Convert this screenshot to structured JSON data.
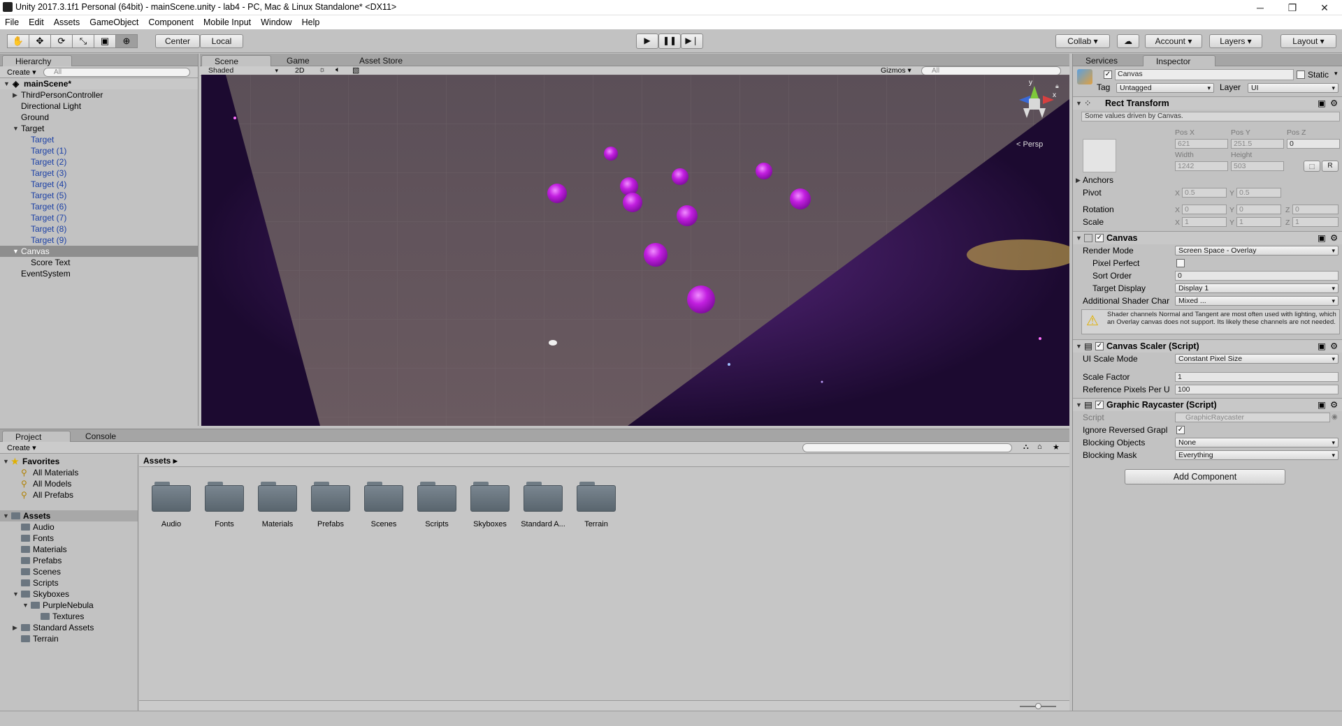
{
  "window": {
    "title": "Unity 2017.3.1f1 Personal (64bit) - mainScene.unity - lab4 - PC, Mac & Linux Standalone* <DX11>"
  },
  "menu": [
    "File",
    "Edit",
    "Assets",
    "GameObject",
    "Component",
    "Mobile Input",
    "Window",
    "Help"
  ],
  "toolbar": {
    "pivot_label": "Center",
    "space_label": "Local",
    "collab_label": "Collab",
    "account_label": "Account",
    "layers_label": "Layers",
    "layout_label": "Layout"
  },
  "hierarchy": {
    "tab_label": "Hierarchy",
    "create_label": "Create",
    "search_placeholder": "All",
    "scene_name": "mainScene*",
    "items": [
      {
        "label": "ThirdPersonController"
      },
      {
        "label": "Directional Light"
      },
      {
        "label": "Ground"
      },
      {
        "label": "Target"
      },
      {
        "label": "Target"
      },
      {
        "label": "Target (1)"
      },
      {
        "label": "Target (2)"
      },
      {
        "label": "Target (3)"
      },
      {
        "label": "Target (4)"
      },
      {
        "label": "Target (5)"
      },
      {
        "label": "Target (6)"
      },
      {
        "label": "Target (7)"
      },
      {
        "label": "Target (8)"
      },
      {
        "label": "Target (9)"
      },
      {
        "label": "Canvas"
      },
      {
        "label": "Score Text"
      },
      {
        "label": "EventSystem"
      }
    ]
  },
  "scene": {
    "tabs": [
      "Scene",
      "Game",
      "Asset Store"
    ],
    "shading": "Shaded",
    "mode_2d": "2D",
    "gizmos_label": "Gizmos",
    "search_placeholder": "All",
    "persp_label": "< Persp",
    "axis_y": "y",
    "axis_x": "x"
  },
  "project": {
    "tabs": [
      "Project",
      "Console"
    ],
    "create_label": "Create",
    "favorites_label": "Favorites",
    "favorites": [
      "All Materials",
      "All Models",
      "All Prefabs"
    ],
    "assets_label": "Assets",
    "asset_tree": [
      "Audio",
      "Fonts",
      "Materials",
      "Prefabs",
      "Scenes",
      "Scripts",
      "Skyboxes",
      "PurpleNebula",
      "Textures",
      "Standard Assets",
      "Terrain"
    ],
    "breadcrumb": "Assets",
    "folders": [
      "Audio",
      "Fonts",
      "Materials",
      "Prefabs",
      "Scenes",
      "Scripts",
      "Skyboxes",
      "Standard A...",
      "Terrain"
    ]
  },
  "inspector": {
    "tabs": [
      "Services",
      "Inspector"
    ],
    "object_name": "Canvas",
    "static_label": "Static",
    "tag_label": "Tag",
    "tag_value": "Untagged",
    "layer_label": "Layer",
    "layer_value": "UI",
    "rect": {
      "title": "Rect Transform",
      "note": "Some values driven by Canvas.",
      "posx_label": "Pos X",
      "posy_label": "Pos Y",
      "posz_label": "Pos Z",
      "posx": "621",
      "posy": "251.5",
      "posz": "0",
      "width_label": "Width",
      "height_label": "Height",
      "width": "1242",
      "height": "503",
      "r_button": "R",
      "anchors_label": "Anchors",
      "pivot_label": "Pivot",
      "pivot_x": "0.5",
      "pivot_y": "0.5",
      "rotation_label": "Rotation",
      "rot_x": "0",
      "rot_y": "0",
      "rot_z": "0",
      "scale_label": "Scale",
      "scale_x": "1",
      "scale_y": "1",
      "scale_z": "1",
      "x": "X",
      "y": "Y",
      "z": "Z"
    },
    "canvas": {
      "title": "Canvas",
      "render_mode_label": "Render Mode",
      "render_mode": "Screen Space - Overlay",
      "pixel_perfect_label": "Pixel Perfect",
      "sort_order_label": "Sort Order",
      "sort_order": "0",
      "target_display_label": "Target Display",
      "target_display": "Display 1",
      "shader_label": "Additional Shader Char",
      "shader_value": "Mixed ...",
      "warning": "Shader channels Normal and Tangent are most often used with lighting, which an Overlay canvas does not support. Its likely these channels are not needed."
    },
    "scaler": {
      "title": "Canvas Scaler (Script)",
      "mode_label": "UI Scale Mode",
      "mode": "Constant Pixel Size",
      "factor_label": "Scale Factor",
      "factor": "1",
      "ref_label": "Reference Pixels Per U",
      "ref": "100"
    },
    "raycaster": {
      "title": "Graphic Raycaster (Script)",
      "script_label": "Script",
      "script": "GraphicRaycaster",
      "ignore_label": "Ignore Reversed Grapl",
      "blocking_label": "Blocking Objects",
      "blocking": "None",
      "mask_label": "Blocking Mask",
      "mask": "Everything"
    },
    "add_component": "Add Component"
  },
  "colors": {
    "accent_blue": "#1a3fa5",
    "selection": "#8e8e8e",
    "target_purple": "#c21fe0"
  }
}
